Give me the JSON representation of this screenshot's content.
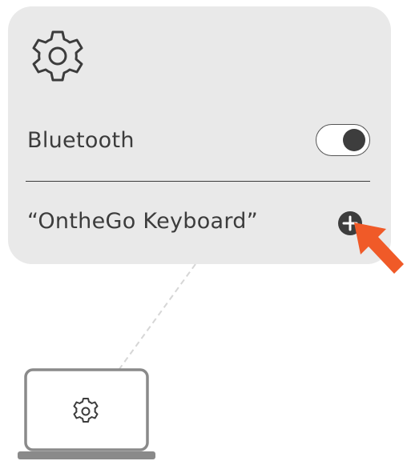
{
  "settings_panel": {
    "icon": "gear-icon",
    "bluetooth_label": "Bluetooth",
    "bluetooth_enabled": true,
    "device_name": "“OntheGo Keyboard”",
    "add_icon": "plus-circle-icon"
  },
  "annotation": {
    "pointer_icon": "arrow-pointer-icon",
    "pointer_color": "#f05a28"
  },
  "laptop": {
    "icon": "laptop-icon",
    "screen_icon": "gear-icon"
  },
  "colors": {
    "panel_bg": "#e9e9e9",
    "text": "#3c3c3c",
    "accent": "#f05a28"
  }
}
